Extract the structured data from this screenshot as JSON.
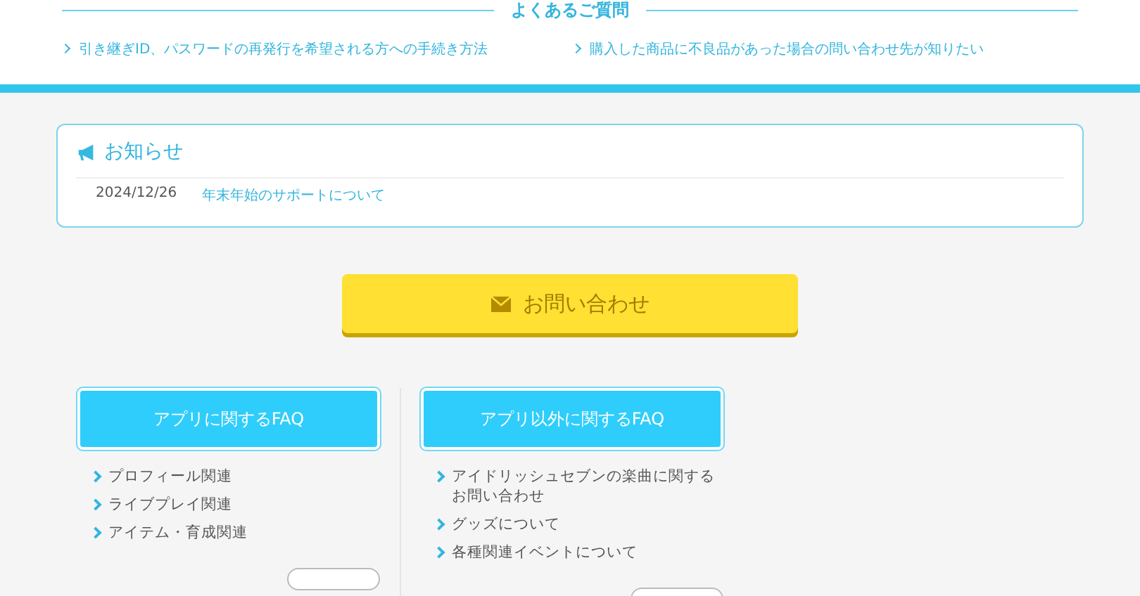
{
  "faq_header": {
    "title": "よくあるご質問",
    "links": [
      "引き継ぎID、パスワードの再発行を希望される方への手続き方法",
      "購入した商品に不良品があった場合の問い合わせ先が知りたい"
    ]
  },
  "notice": {
    "title": "お知らせ",
    "items": [
      {
        "date": "2024/12/26",
        "title": "年末年始のサポートについて"
      }
    ]
  },
  "contact_button": {
    "label": "お問い合わせ"
  },
  "faq_categories": [
    {
      "title": "アプリに関するFAQ",
      "items": [
        "プロフィール関連",
        "ライブプレイ関連",
        "アイテム・育成関連"
      ]
    },
    {
      "title": "アプリ以外に関するFAQ",
      "items": [
        "アイドリッシュセブンの楽曲に関するお問い合わせ",
        "グッズについて",
        "各種関連イベントについて"
      ]
    }
  ]
}
